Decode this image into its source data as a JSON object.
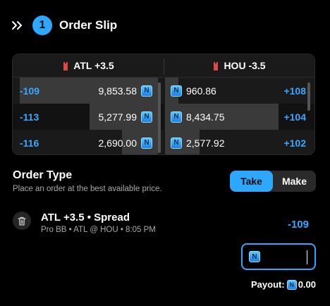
{
  "header": {
    "step": "1",
    "title": "Order Slip"
  },
  "book": {
    "left_team": {
      "label": "ATL +3.5",
      "color": "#e04848"
    },
    "right_team": {
      "label": "HOU -3.5",
      "color": "#e04848"
    },
    "left_rows": [
      {
        "odds": "-109",
        "amount": "9,853.58",
        "depth": 0.95
      },
      {
        "odds": "-113",
        "amount": "5,277.99",
        "depth": 0.47
      },
      {
        "odds": "-116",
        "amount": "2,690.00",
        "depth": 0.25
      }
    ],
    "right_rows": [
      {
        "odds": "+108",
        "amount": "960.86",
        "depth": 0.09
      },
      {
        "odds": "+104",
        "amount": "8,434.75",
        "depth": 0.78
      },
      {
        "odds": "+102",
        "amount": "2,577.92",
        "depth": 0.24
      }
    ]
  },
  "order_type": {
    "title": "Order Type",
    "subtitle": "Place an order at the best available price.",
    "take_label": "Take",
    "make_label": "Make",
    "selected": "Take"
  },
  "bet": {
    "title": "ATL +3.5 • Spread",
    "meta": "Pro BB  •  ATL @ HOU  •  8:05 PM",
    "odds": "-109"
  },
  "stake": {
    "value": "",
    "placeholder": ""
  },
  "payout": {
    "label": "Payout:",
    "value": "0.00"
  },
  "icons": {
    "collapse": "double-chevron-right-icon",
    "jersey": "jersey-icon",
    "coin": "coin-icon",
    "trash": "trash-icon"
  },
  "colors": {
    "accent": "#2ea8ff",
    "odds_text": "#3aa7ff",
    "background": "#000000"
  }
}
